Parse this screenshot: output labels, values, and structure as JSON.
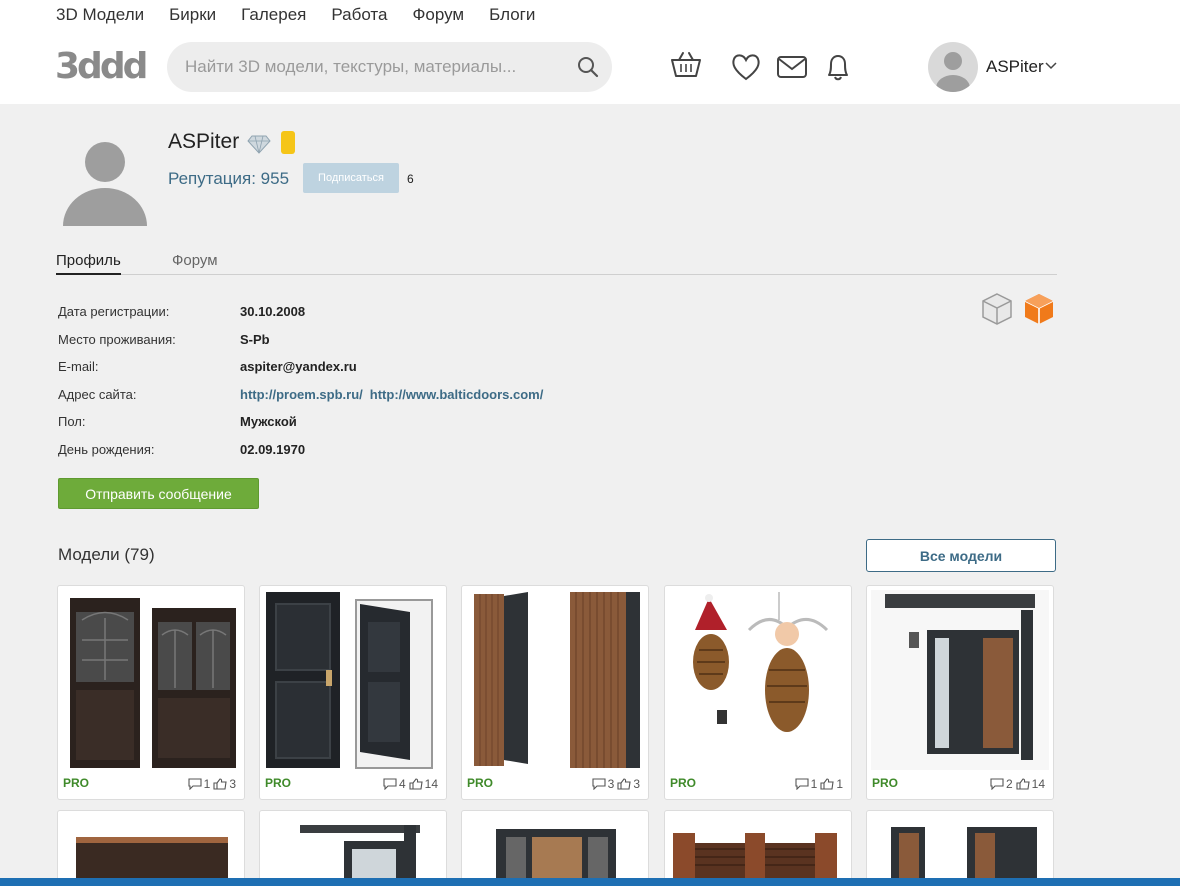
{
  "nav": [
    "3D Модели",
    "Бирки",
    "Галерея",
    "Работа",
    "Форум",
    "Блоги"
  ],
  "logo": "3ddd",
  "search": {
    "placeholder": "Найти 3D модели, текстуры, материалы..."
  },
  "header_user": {
    "name": "ASPiter"
  },
  "profile": {
    "name": "ASPiter",
    "reputation": "Репутация: 955",
    "subscribe_label": "Подписаться",
    "subscribers": "6"
  },
  "tabs": [
    {
      "label": "Профиль",
      "active": true
    },
    {
      "label": "Форум",
      "active": false
    }
  ],
  "info": {
    "reg_label": "Дата регистрации:",
    "reg_value": "30.10.2008",
    "city_label": "Место проживания:",
    "city_value": "S-Pb",
    "email_label": "E-mail:",
    "email_value": "aspiter@yandex.ru",
    "site_label": "Адрес сайта:",
    "site_links": [
      "http://proem.spb.ru/",
      "http://www.balticdoors.com/"
    ],
    "gender_label": "Пол:",
    "gender_value": "Мужской",
    "bday_label": "День рождения:",
    "bday_value": "02.09.1970"
  },
  "send_message": "Отправить сообщение",
  "models": {
    "title": "Модели (79)",
    "all_label": "Все модели",
    "cards": [
      {
        "badge": "PRO",
        "comments": "1",
        "likes": "3"
      },
      {
        "badge": "PRO",
        "comments": "4",
        "likes": "14"
      },
      {
        "badge": "PRO",
        "comments": "3",
        "likes": "3"
      },
      {
        "badge": "PRO",
        "comments": "1",
        "likes": "1"
      },
      {
        "badge": "PRO",
        "comments": "2",
        "likes": "14"
      }
    ]
  },
  "colors": {
    "accent_link": "#3d6b86",
    "send_button": "#6eab3a",
    "pro_badge": "#3f8a2a",
    "cube_orange": "#f07a1a"
  }
}
